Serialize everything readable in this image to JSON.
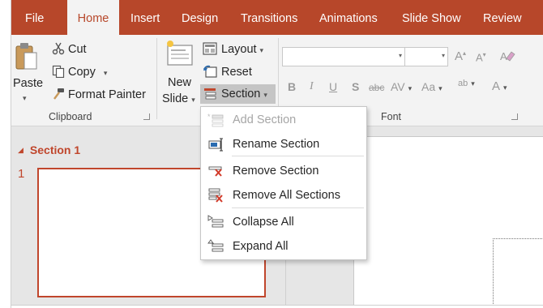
{
  "tabs": [
    "File",
    "Home",
    "Insert",
    "Design",
    "Transitions",
    "Animations",
    "Slide Show",
    "Review"
  ],
  "active_tab": "Home",
  "clipboard": {
    "paste_label": "Paste",
    "cut_label": "Cut",
    "copy_label": "Copy",
    "format_painter_label": "Format Painter",
    "group_label": "Clipboard"
  },
  "slides_group": {
    "new_slide_line1": "New",
    "new_slide_line2": "Slide",
    "layout_label": "Layout",
    "reset_label": "Reset",
    "section_label": "Section"
  },
  "font_group": {
    "font_name_value": "",
    "font_size_value": "",
    "grow_font": "A",
    "shrink_font": "A",
    "bold": "B",
    "italic": "I",
    "underline": "U",
    "shadow": "S",
    "strikethrough": "abc",
    "char_spacing": "AV",
    "change_case": "Aa",
    "highlight": "ab",
    "font_color": "A",
    "group_label": "Font"
  },
  "section_menu": {
    "items": [
      {
        "label": "Add Section",
        "enabled": false,
        "icon": "add-section-icon"
      },
      {
        "label": "Rename Section",
        "enabled": true,
        "icon": "rename-section-icon"
      },
      {
        "label": "Remove Section",
        "enabled": true,
        "icon": "remove-section-icon"
      },
      {
        "label": "Remove All Sections",
        "enabled": true,
        "icon": "remove-all-sections-icon"
      },
      {
        "label": "Collapse All",
        "enabled": true,
        "icon": "collapse-all-icon"
      },
      {
        "label": "Expand All",
        "enabled": true,
        "icon": "expand-all-icon"
      }
    ]
  },
  "thumbnail_pane": {
    "section_name": "Section 1",
    "slide_number": "1"
  },
  "colors": {
    "accent": "#b7472a",
    "section_text": "#c0462c",
    "ribbon_bg": "#f3f3f3",
    "pane_bg": "#e6e6e6"
  }
}
